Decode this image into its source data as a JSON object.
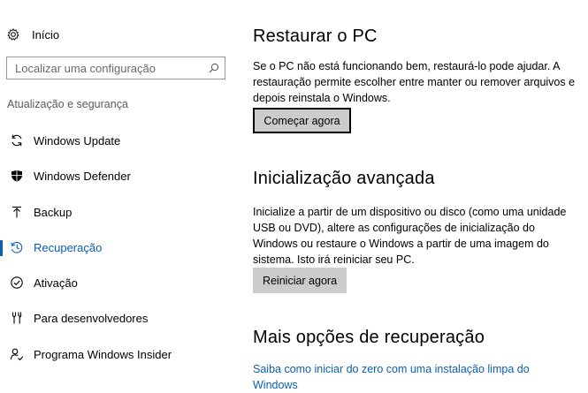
{
  "sidebar": {
    "home_label": "Início",
    "search": {
      "placeholder": "Localizar uma configuração"
    },
    "section_label": "Atualização e segurança",
    "items": [
      {
        "label": "Windows Update",
        "icon": "sync-icon"
      },
      {
        "label": "Windows Defender",
        "icon": "shield-icon"
      },
      {
        "label": "Backup",
        "icon": "backup-arrow-icon"
      },
      {
        "label": "Recuperação",
        "icon": "recovery-clock-icon",
        "active": true
      },
      {
        "label": "Ativação",
        "icon": "check-circle-icon"
      },
      {
        "label": "Para desenvolvedores",
        "icon": "developer-tools-icon"
      },
      {
        "label": "Programa Windows Insider",
        "icon": "insider-person-icon"
      }
    ]
  },
  "main": {
    "reset": {
      "title": "Restaurar o PC",
      "description": "Se o PC não está funcionando bem, restaurá-lo pode ajudar. A restauração permite escolher entre manter ou remover arquivos e depois reinstala o Windows.",
      "button": "Começar agora"
    },
    "advanced": {
      "title": "Inicialização avançada",
      "description": "Inicialize a partir de um dispositivo ou disco (como uma unidade USB ou DVD), altere as configurações de inicialização do Windows ou restaure o Windows a partir de uma imagem do sistema. Isto irá reiniciar seu PC.",
      "button": "Reiniciar agora"
    },
    "more": {
      "title": "Mais opções de recuperação",
      "link": "Saiba como iniciar do zero com uma instalação limpa do Windows"
    }
  },
  "colors": {
    "accent": "#0a5fb4",
    "button_bg": "#cccccc",
    "section_text": "#5a5a5a"
  }
}
